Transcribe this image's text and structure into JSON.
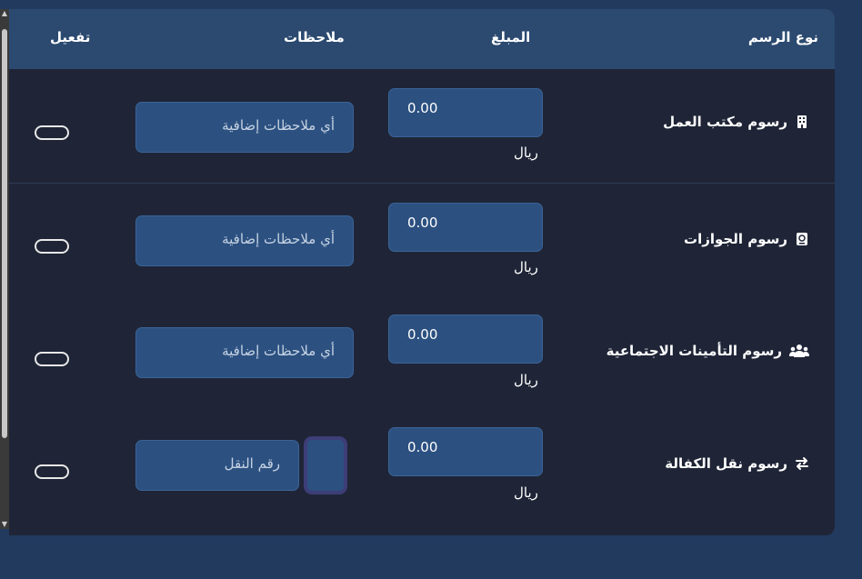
{
  "table": {
    "headers": {
      "fee_type": "نوع الرسم",
      "amount": "المبلغ",
      "notes": "ملاحظات",
      "enable": "تفعيل"
    },
    "rows": [
      {
        "label": "رسوم مكتب العمل",
        "icon": "building-icon",
        "amount": "0.00",
        "currency": "ريال",
        "notes_placeholder": "أي ملاحظات إضافية",
        "enabled": false
      },
      {
        "label": "رسوم الجوازات",
        "icon": "passport-icon",
        "amount": "0.00",
        "currency": "ريال",
        "notes_placeholder": "أي ملاحظات إضافية",
        "enabled": false
      },
      {
        "label": "رسوم التأمينات الاجتماعية",
        "icon": "users-icon",
        "amount": "0.00",
        "currency": "ريال",
        "notes_placeholder": "أي ملاحظات إضافية",
        "enabled": false
      },
      {
        "label": "رسوم نقل الكفالة",
        "icon": "transfer-arrows-icon",
        "amount": "0.00",
        "currency": "ريال",
        "transfer_placeholder": "رقم النقل",
        "enabled": false
      }
    ]
  },
  "colors": {
    "page_bg": "#213a5e",
    "panel_bg": "#1f2537",
    "header_bg": "#2c4a70",
    "input_bg": "#2c5181"
  }
}
